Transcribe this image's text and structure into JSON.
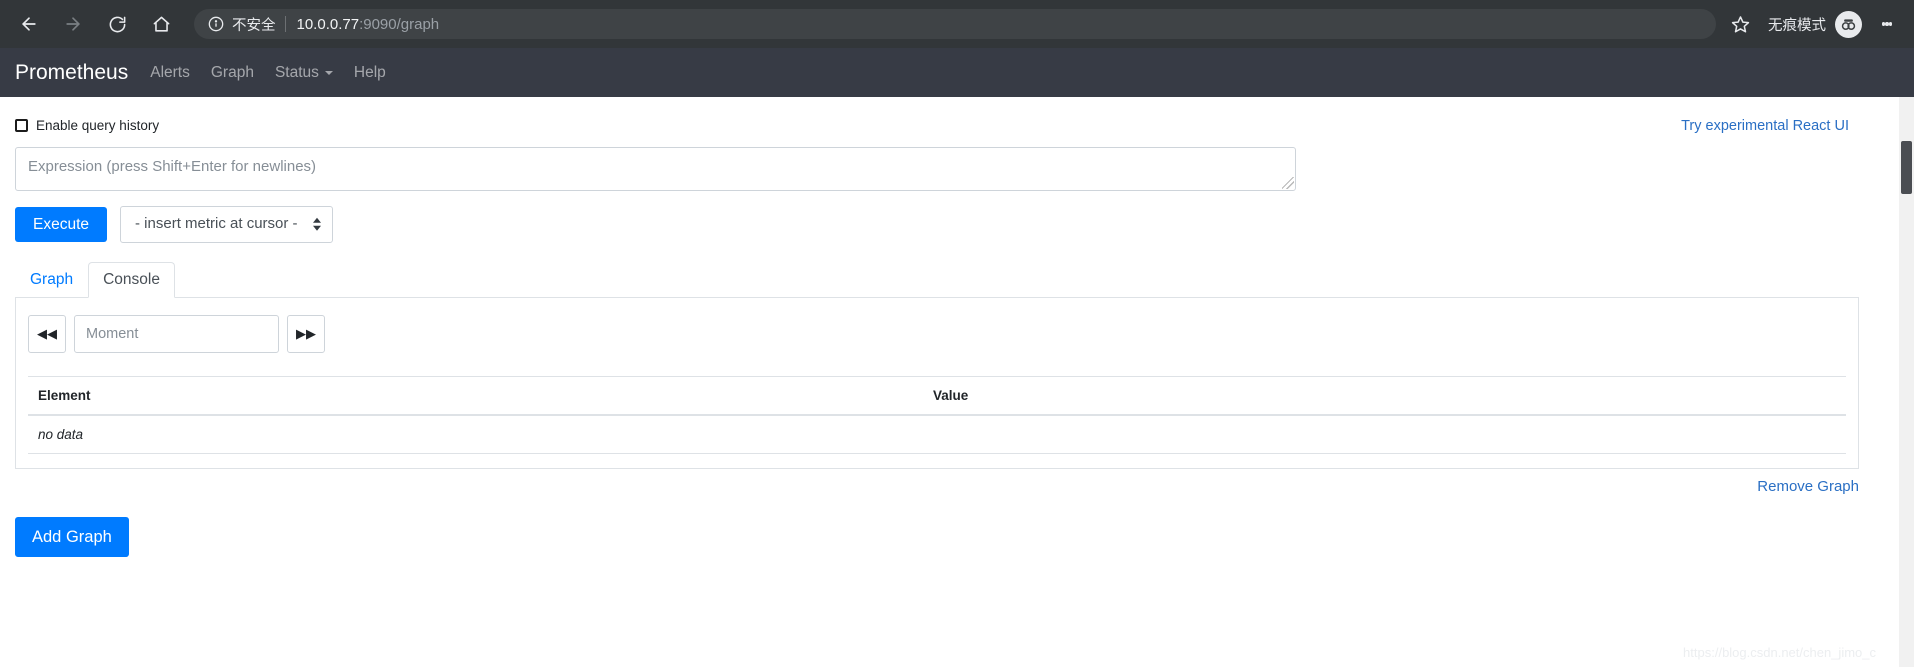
{
  "browser": {
    "back_icon": "back-arrow-icon",
    "forward_icon": "forward-arrow-icon",
    "reload_icon": "reload-icon",
    "home_icon": "home-icon",
    "security_icon": "info-circle-icon",
    "security_text": "不安全",
    "url_host": "10.0.0.77",
    "url_rest": ":9090/graph",
    "star_icon": "star-icon",
    "incognito_label": "无痕模式",
    "incognito_icon": "incognito-spy-icon",
    "menu_icon": "three-dot-menu-icon",
    "colors": {
      "chrome_bg": "#323639",
      "omnibox_bg": "#3f4346"
    }
  },
  "navbar": {
    "brand": "Prometheus",
    "links": [
      {
        "label": "Alerts",
        "has_caret": false
      },
      {
        "label": "Graph",
        "has_caret": false
      },
      {
        "label": "Status",
        "has_caret": true
      },
      {
        "label": "Help",
        "has_caret": false
      }
    ],
    "bg_color": "#373b45"
  },
  "main": {
    "history_label": "Enable query history",
    "history_checked": false,
    "react_ui_link": "Try experimental React UI",
    "expression_placeholder": "Expression (press Shift+Enter for newlines)",
    "expression_value": "",
    "execute_label": "Execute",
    "metric_select_value": "- insert metric at cursor -",
    "tabs": [
      {
        "label": "Graph",
        "active": false
      },
      {
        "label": "Console",
        "active": true
      }
    ],
    "console": {
      "step_back_label": "◀◀",
      "step_forward_label": "▶▶",
      "moment_placeholder": "Moment",
      "moment_value": "",
      "table": {
        "headers": [
          "Element",
          "Value"
        ],
        "rows": [],
        "empty_text": "no data"
      }
    },
    "remove_graph_label": "Remove Graph",
    "add_graph_label": "Add Graph",
    "accent_color": "#007bff",
    "link_color": "#2a6fc4"
  },
  "watermark": "https://blog.csdn.net/chen_jimo_c"
}
